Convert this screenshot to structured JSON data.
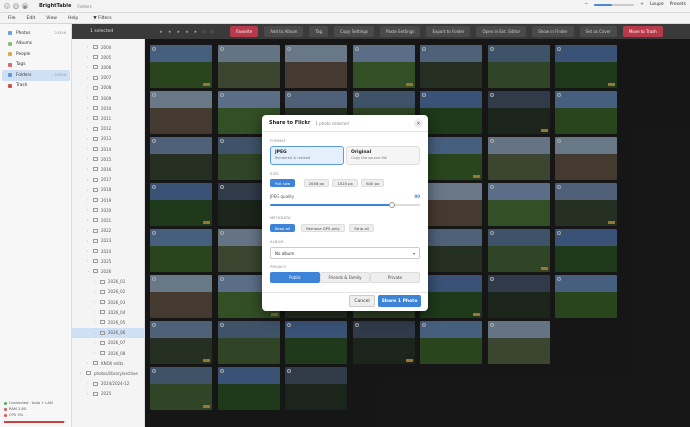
{
  "window": {
    "app_name": "BrightTable",
    "subtitle": "Folders",
    "right_links": [
      "Loupe",
      "Presets"
    ]
  },
  "menu": {
    "items": [
      "File",
      "Edit",
      "View",
      "Help"
    ],
    "filters_label": "Filters"
  },
  "sidebar": {
    "items": [
      {
        "label": "Photos",
        "count": "24356",
        "color": "#6aa0e0"
      },
      {
        "label": "Albums",
        "count": "",
        "color": "#8bc06a"
      },
      {
        "label": "People",
        "count": "",
        "color": "#e0a84a"
      },
      {
        "label": "Tags",
        "count": "",
        "color": "#d46a6a"
      },
      {
        "label": "Folders",
        "count": "24356",
        "color": "#5a9be0",
        "active": true
      },
      {
        "label": "Trash",
        "count": "",
        "color": "#d05050"
      }
    ],
    "status": [
      {
        "text": "Connected · Auto + LAN",
        "color": "#4caf50"
      },
      {
        "text": "RAM 2.8G",
        "color": "#e05050"
      },
      {
        "text": "CPU 5%",
        "color": "#e05050"
      }
    ],
    "progress": 0.97
  },
  "folders": {
    "items": [
      {
        "label": "2004",
        "indent": 1
      },
      {
        "label": "2005",
        "indent": 1
      },
      {
        "label": "2006",
        "indent": 1
      },
      {
        "label": "2007",
        "indent": 1
      },
      {
        "label": "2008",
        "indent": 1
      },
      {
        "label": "2009",
        "indent": 1
      },
      {
        "label": "2010",
        "indent": 1
      },
      {
        "label": "2011",
        "indent": 1
      },
      {
        "label": "2012",
        "indent": 1
      },
      {
        "label": "2013",
        "indent": 1
      },
      {
        "label": "2014",
        "indent": 1
      },
      {
        "label": "2015",
        "indent": 1
      },
      {
        "label": "2016",
        "indent": 1
      },
      {
        "label": "2017",
        "indent": 1
      },
      {
        "label": "2018",
        "indent": 1
      },
      {
        "label": "2019",
        "indent": 1
      },
      {
        "label": "2020",
        "indent": 1
      },
      {
        "label": "2021",
        "indent": 1
      },
      {
        "label": "2022",
        "indent": 1
      },
      {
        "label": "2023",
        "indent": 1
      },
      {
        "label": "2024",
        "indent": 1
      },
      {
        "label": "2025",
        "indent": 1
      },
      {
        "label": "2026",
        "indent": 1,
        "open": true
      },
      {
        "label": "2026_01",
        "indent": 2
      },
      {
        "label": "2026_02",
        "indent": 2
      },
      {
        "label": "2026_03",
        "indent": 2
      },
      {
        "label": "2026_04",
        "indent": 2
      },
      {
        "label": "2026_05",
        "indent": 2
      },
      {
        "label": "2026_06",
        "indent": 2,
        "selected": true
      },
      {
        "label": "2026_07",
        "indent": 2
      },
      {
        "label": "2026_08",
        "indent": 2
      },
      {
        "label": "KNOX edits",
        "indent": 1
      },
      {
        "label": "photos/library/archive",
        "indent": 0
      },
      {
        "label": "2024/2024-12",
        "indent": 1
      },
      {
        "label": "2025",
        "indent": 1
      }
    ]
  },
  "actionbar": {
    "selected": "1 selected",
    "ratings": [
      "★",
      "★",
      "★",
      "★",
      "★",
      "○",
      "○"
    ],
    "buttons": [
      {
        "label": "Favorite",
        "style": "red"
      },
      {
        "label": "Add to Album",
        "style": ""
      },
      {
        "label": "Tag",
        "style": ""
      },
      {
        "label": "Copy Settings",
        "style": ""
      },
      {
        "label": "Paste Settings",
        "style": ""
      },
      {
        "label": "Export to Folder",
        "style": ""
      },
      {
        "label": "Open in Ext. Editor",
        "style": ""
      },
      {
        "label": "Show in Finder",
        "style": ""
      },
      {
        "label": "Set as Cover",
        "style": ""
      },
      {
        "label": "Move to Trash",
        "style": "red"
      }
    ]
  },
  "dialog": {
    "title": "Share to Flickr",
    "subtitle": "1 photo selected",
    "close": "×",
    "format_label": "FORMAT",
    "formats": [
      {
        "title": "JPEG",
        "desc": "Rendered & resized",
        "selected": true
      },
      {
        "title": "Original",
        "desc": "Copy the source file",
        "selected": false
      }
    ],
    "size_label": "SIZE",
    "sizes": [
      {
        "label": "Full size",
        "selected": true
      },
      {
        "label": "2048 px",
        "selected": false
      },
      {
        "label": "1024 px",
        "selected": false
      },
      {
        "label": "640 px",
        "selected": false
      }
    ],
    "quality_label": "JPEG quality",
    "quality_value": "90",
    "quality": 0.9,
    "metadata_label": "METADATA",
    "metadata": [
      {
        "label": "Keep all",
        "selected": true
      },
      {
        "label": "Remove GPS only",
        "selected": false
      },
      {
        "label": "Strip all",
        "selected": false
      }
    ],
    "album_label": "ALBUM",
    "album_value": "No album",
    "privacy_label": "PRIVACY",
    "privacy": [
      {
        "label": "Public",
        "selected": true
      },
      {
        "label": "Friends & Family",
        "selected": false
      },
      {
        "label": "Private",
        "selected": false
      }
    ],
    "cancel_label": "Cancel",
    "share_label": "Share 1 Photo"
  }
}
